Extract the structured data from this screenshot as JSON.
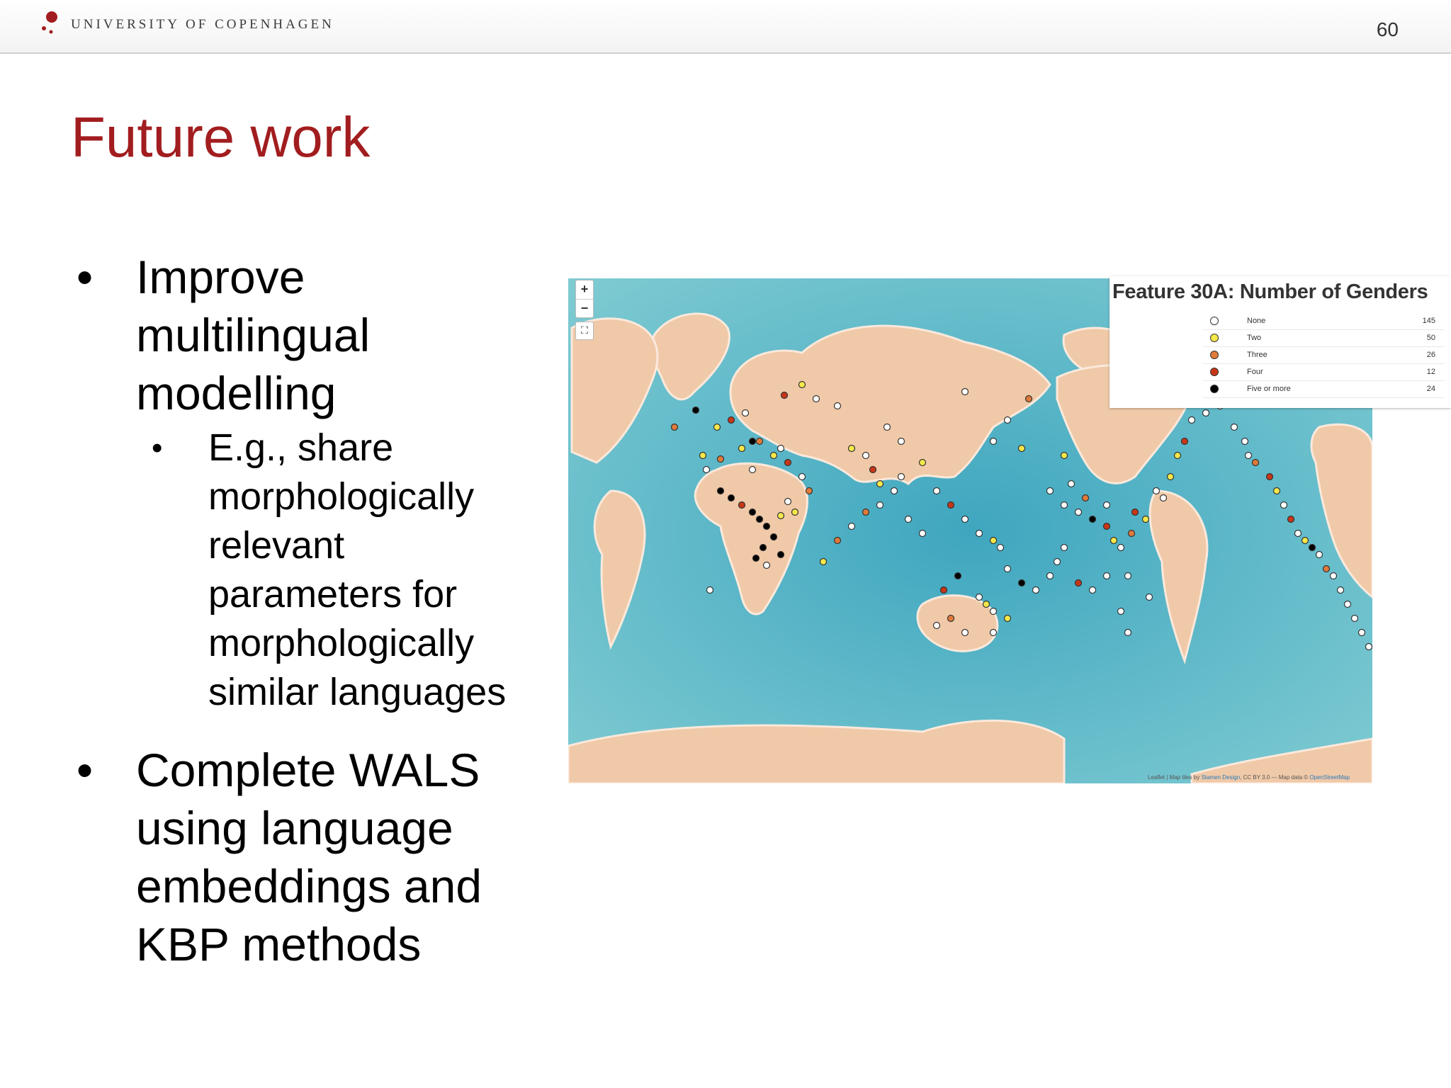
{
  "header": {
    "university": "UNIVERSITY OF COPENHAGEN",
    "page_number": "60",
    "brand_color": "#a21d1f"
  },
  "title": "Future work",
  "bullets": [
    {
      "text": "Improve multilingual modelling",
      "sub": [
        "E.g., share morphologically relevant parameters for morphologically similar languages"
      ]
    },
    {
      "text": "Complete WALS using language embeddings and KBP methods",
      "sub": []
    }
  ],
  "map": {
    "zoom_in": "+",
    "zoom_out": "−",
    "fullscreen_icon": "fullscreen-icon",
    "legend": {
      "title": "Feature 30A: Number of Genders",
      "items": [
        {
          "label": "None",
          "count": "145",
          "color": "#ffffff"
        },
        {
          "label": "Two",
          "count": "50",
          "color": "#f5e84a"
        },
        {
          "label": "Three",
          "count": "26",
          "color": "#e07a3a"
        },
        {
          "label": "Four",
          "count": "12",
          "color": "#c83618"
        },
        {
          "label": "Five or more",
          "count": "24",
          "color": "#000000"
        }
      ]
    },
    "attribution": {
      "prefix": "Leaflet | Map tiles by",
      "tiles_link": "Stamen Design",
      "middle": ", CC BY 3.0 — Map data ©",
      "data_link": "OpenStreetMap"
    },
    "colors": {
      "ocean": "#5ab8c8",
      "land": "#f0c9a8"
    }
  }
}
